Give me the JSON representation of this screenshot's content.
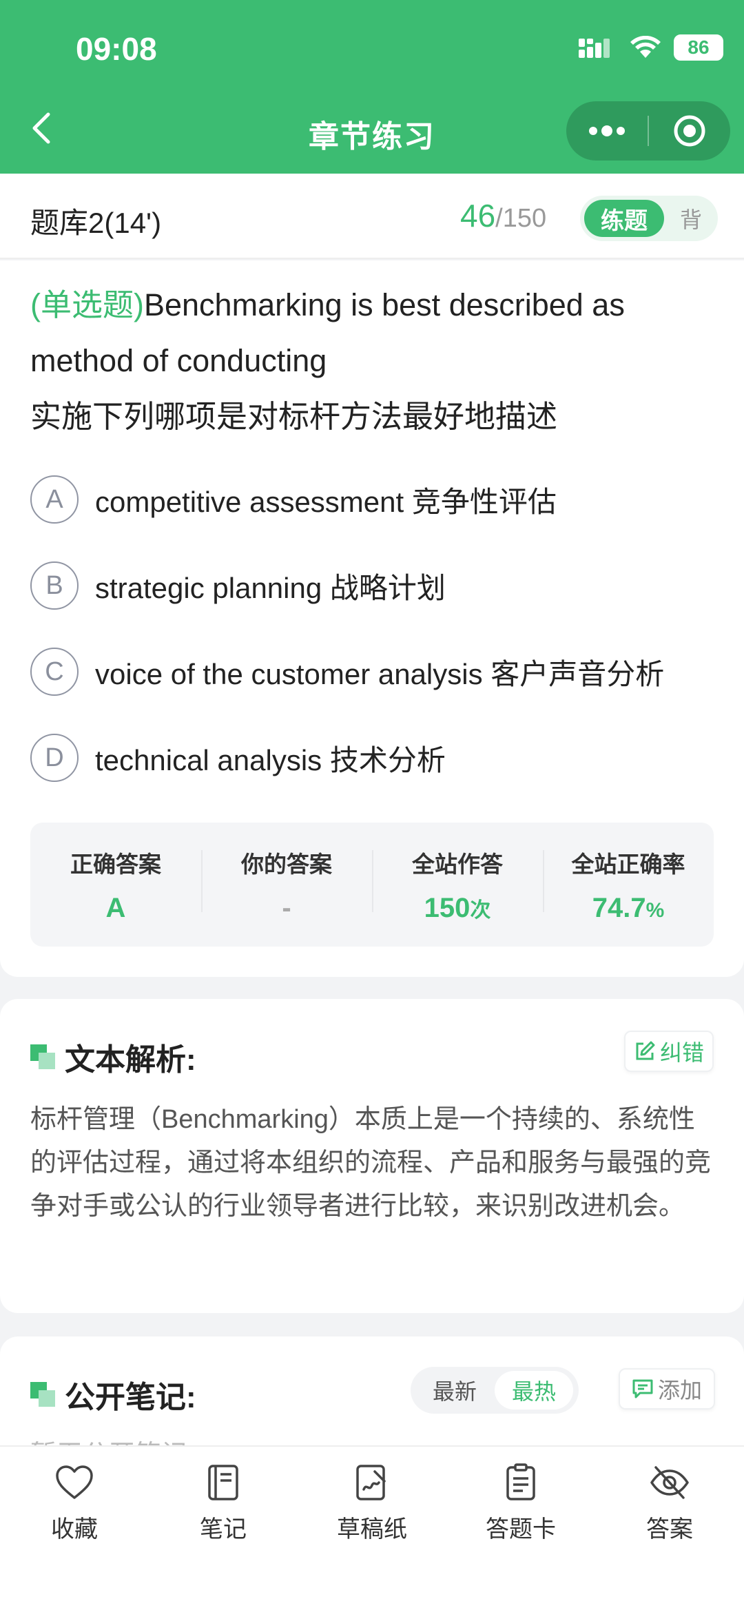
{
  "status": {
    "time": "09:08",
    "battery": "86"
  },
  "header": {
    "title": "章节练习"
  },
  "subheader": {
    "bank_name": "题库2(14')",
    "current": "46",
    "separator": "/",
    "total": "150",
    "mode_active": "练题",
    "mode_inactive": "背"
  },
  "question": {
    "type": "(单选题)",
    "text_en": "Benchmarking is best described as method of conducting",
    "text_zh": "实施下列哪项是对标杆方法最好地描述",
    "options": [
      {
        "letter": "A",
        "text": "competitive assessment 竞争性评估"
      },
      {
        "letter": "B",
        "text": "strategic planning 战略计划"
      },
      {
        "letter": "C",
        "text": "voice of the customer analysis 客户声音分析"
      },
      {
        "letter": "D",
        "text": "technical analysis 技术分析"
      }
    ]
  },
  "answer_stats": {
    "correct_label": "正确答案",
    "correct_value": "A",
    "yours_label": "你的答案",
    "yours_value": "-",
    "total_label": "全站作答",
    "total_value": "150",
    "total_unit": "次",
    "rate_label": "全站正确率",
    "rate_value": "74.7",
    "rate_unit": "%"
  },
  "explanation": {
    "title": "文本解析:",
    "correct_button": "纠错",
    "text": "标杆管理（Benchmarking）本质上是一个持续的、系统性的评估过程，通过将本组织的流程、产品和服务与最强的竞争对手或公认的行业领导者进行比较，来识别改进机会。"
  },
  "notes": {
    "title": "公开笔记:",
    "sort_latest": "最新",
    "sort_hot": "最热",
    "add_button": "添加",
    "empty_text": "暂无公开笔记"
  },
  "bottom_tabs": [
    {
      "icon": "heart-icon",
      "label": "收藏"
    },
    {
      "icon": "notebook-icon",
      "label": "笔记"
    },
    {
      "icon": "draft-paper-icon",
      "label": "草稿纸"
    },
    {
      "icon": "answer-card-icon",
      "label": "答题卡"
    },
    {
      "icon": "eye-off-icon",
      "label": "答案"
    }
  ],
  "colors": {
    "brand": "#3cbc72"
  }
}
